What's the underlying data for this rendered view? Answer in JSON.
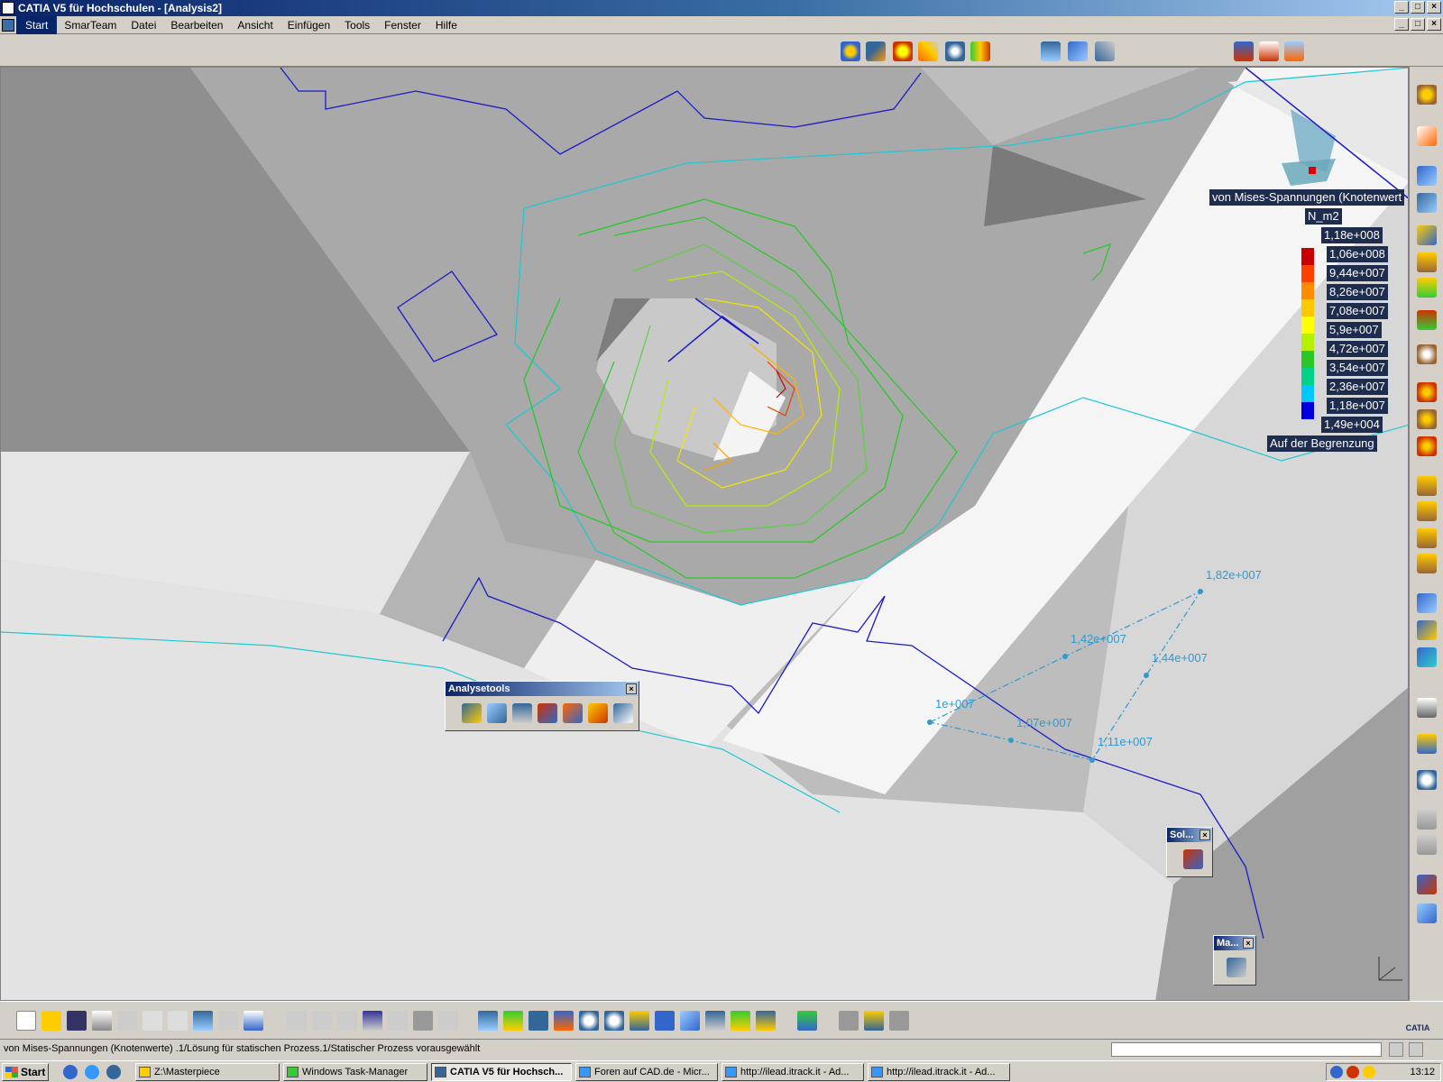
{
  "window": {
    "title": "CATIA V5 für Hochschulen - [Analysis2]"
  },
  "menu": [
    "Start",
    "SmarTeam",
    "Datei",
    "Bearbeiten",
    "Ansicht",
    "Einfügen",
    "Tools",
    "Fenster",
    "Hilfe"
  ],
  "legend": {
    "title": "von Mises-Spannungen (Knotenwert",
    "unit": "N_m2",
    "values": [
      "1,18e+008",
      "1,06e+008",
      "9,44e+007",
      "8,26e+007",
      "7,08e+007",
      "5,9e+007",
      "4,72e+007",
      "3,54e+007",
      "2,36e+007",
      "1,18e+007",
      "1,49e+004"
    ],
    "colors": [
      "#c80000",
      "#ff4000",
      "#ff8c00",
      "#ffc800",
      "#ffff00",
      "#b4f000",
      "#28c828",
      "#00d28c",
      "#00c8ff",
      "#0000dc"
    ],
    "footer": "Auf der Begrenzung"
  },
  "annotations": [
    "1,82e+007",
    "1,42e+007",
    "1,44e+007",
    "1e+007",
    "1,07e+007",
    "1,11e+007"
  ],
  "analysetools": {
    "title": "Analysetools"
  },
  "sol_toolbar": {
    "title": "Sol..."
  },
  "ma_toolbar": {
    "title": "Ma..."
  },
  "status": {
    "text": "von Mises-Spannungen (Knotenwerte) .1/Lösung für statischen Prozess.1/Statischer Prozess vorausgewählt"
  },
  "taskbar": {
    "start": "Start",
    "tasks": [
      "Z:\\Masterpiece",
      "Windows Task-Manager",
      "CATIA V5 für Hochsch...",
      "Foren auf CAD.de - Micr...",
      "http://ilead.itrack.it - Ad...",
      "http://ilead.itrack.it - Ad..."
    ],
    "clock": "13:12"
  },
  "brand": "CATIA",
  "colors": {
    "title_bar": "#0a246a",
    "background": "#d4d0c8",
    "label_blue": "#2f9ad0"
  }
}
